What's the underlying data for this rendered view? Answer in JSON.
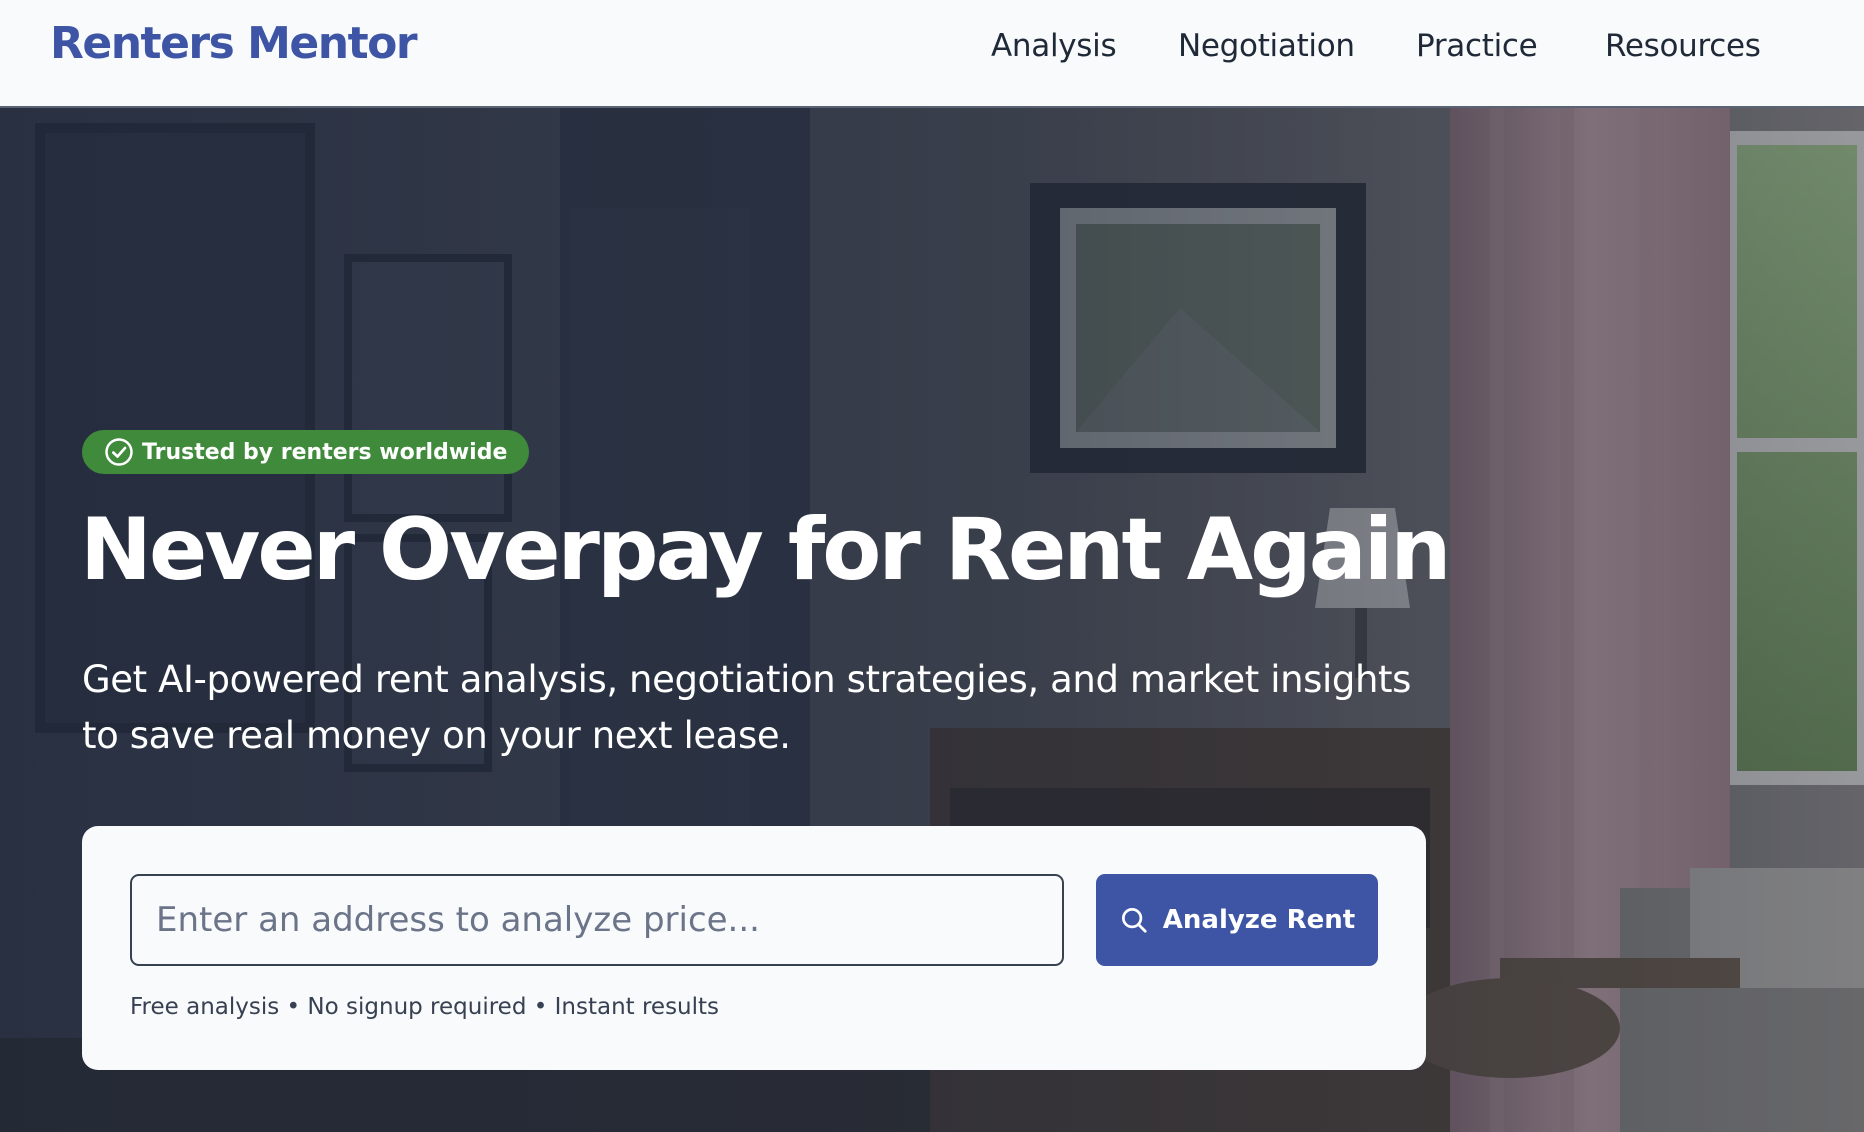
{
  "header": {
    "logo": "Renters Mentor",
    "nav": [
      "Analysis",
      "Negotiation",
      "Practice",
      "Resources"
    ]
  },
  "hero": {
    "badge": "Trusted by renters worldwide",
    "badge_icon": "check-circle-icon",
    "headline": "Never Overpay for Rent Again",
    "subhead_line1": "Get AI-powered rent analysis, negotiation strategies, and market insights",
    "subhead_line2": "to save real money on your next lease.",
    "search": {
      "placeholder": "Enter an address to analyze price...",
      "value": "",
      "button_label": "Analyze Rent",
      "button_icon": "search-icon",
      "note": "Free analysis • No signup required • Instant results"
    }
  },
  "colors": {
    "brand": "#3e55a5",
    "badge_green": "#3f8a3b",
    "header_bg": "#f8fafc",
    "text_dark": "#1f2937"
  }
}
